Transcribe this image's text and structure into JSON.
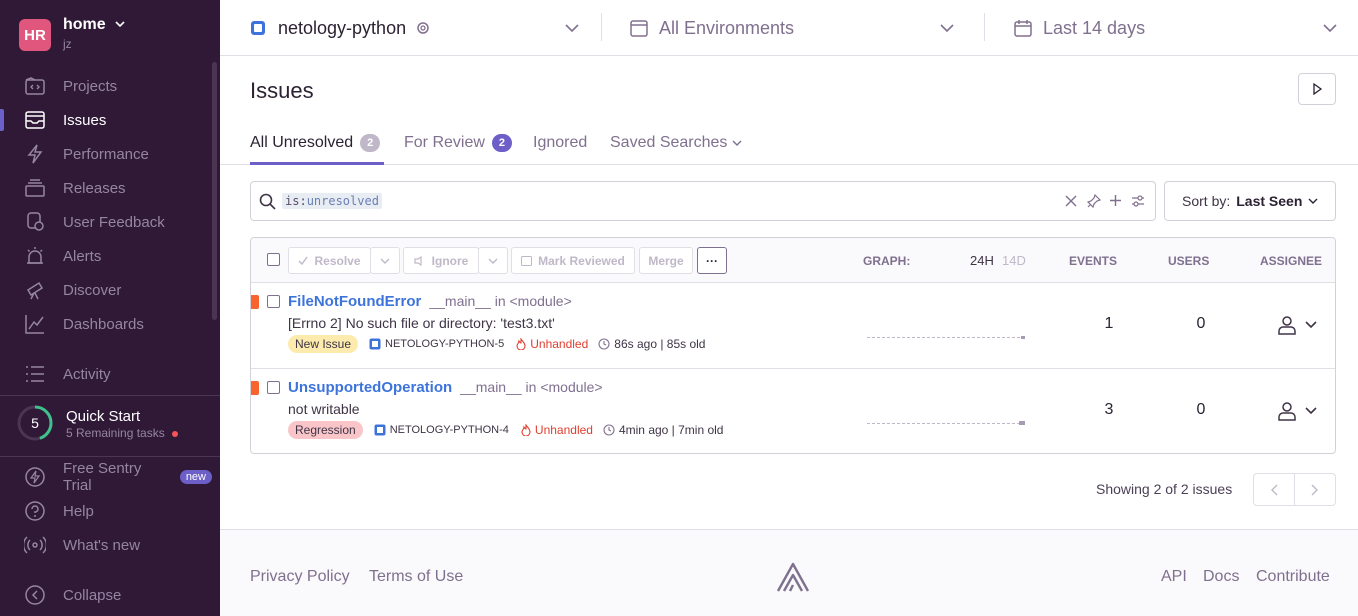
{
  "sidebar": {
    "org": {
      "initials": "HR",
      "name": "home",
      "user": "jz"
    },
    "items": [
      {
        "label": "Projects"
      },
      {
        "label": "Issues"
      },
      {
        "label": "Performance"
      },
      {
        "label": "Releases"
      },
      {
        "label": "User Feedback"
      },
      {
        "label": "Alerts"
      },
      {
        "label": "Discover"
      },
      {
        "label": "Dashboards"
      },
      {
        "label": "Activity"
      }
    ],
    "quick_start": {
      "count": "5",
      "title": "Quick Start",
      "subtitle": "5 Remaining tasks",
      "progress": 0.45
    },
    "bottom": [
      {
        "label": "Free Sentry Trial",
        "badge": "new"
      },
      {
        "label": "Help"
      },
      {
        "label": "What's new"
      },
      {
        "label": "Collapse"
      }
    ]
  },
  "topbar": {
    "project": "netology-python",
    "environment": "All Environments",
    "period": "Last 14 days"
  },
  "page": {
    "title": "Issues"
  },
  "tabs": [
    {
      "label": "All Unresolved",
      "count": "2"
    },
    {
      "label": "For Review",
      "count": "2"
    },
    {
      "label": "Ignored"
    },
    {
      "label": "Saved Searches"
    }
  ],
  "search": {
    "token_key": "is:",
    "token_value": "unresolved"
  },
  "sort": {
    "prefix": "Sort by:",
    "value": "Last Seen"
  },
  "toolbar": {
    "resolve": "Resolve",
    "ignore": "Ignore",
    "mark_reviewed": "Mark Reviewed",
    "merge": "Merge",
    "more": "···"
  },
  "columns": {
    "graph": "GRAPH:",
    "range_24h": "24h",
    "range_14d": "14d",
    "events": "EVENTS",
    "users": "USERS",
    "assignee": "ASSIGNEE"
  },
  "issues": [
    {
      "title": "FileNotFoundError",
      "location": "__main__ in <module>",
      "message": "[Errno 2] No such file or directory: 'test3.txt'",
      "tag": "New Issue",
      "short_id": "NETOLOGY-PYTHON-5",
      "mechanism": "Unhandled",
      "age": "86s ago | 85s old",
      "events": "1",
      "users": "0"
    },
    {
      "title": "UnsupportedOperation",
      "location": "__main__ in <module>",
      "message": "not writable",
      "tag": "Regression",
      "short_id": "NETOLOGY-PYTHON-4",
      "mechanism": "Unhandled",
      "age": "4min ago | 7min old",
      "events": "3",
      "users": "0"
    }
  ],
  "pagination": {
    "summary": "Showing 2 of 2 issues"
  },
  "footer": {
    "privacy": "Privacy Policy",
    "terms": "Terms of Use",
    "api": "API",
    "docs": "Docs",
    "contribute": "Contribute"
  },
  "colors": {
    "sidebar_bg": "#2f1937",
    "accent": "#6c5fc7",
    "link": "#3d74db",
    "error_mark": "#f9642e",
    "new_issue_tag": "#fdebad",
    "regression_tag": "#f9c5c8",
    "unhandled": "#e03e2f"
  }
}
